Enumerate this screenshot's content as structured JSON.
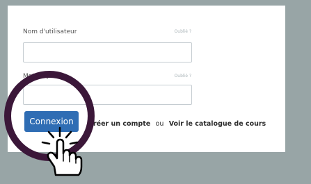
{
  "login_form": {
    "username_label": "Nom d'utilisateur",
    "username_forgot": "Oublié ?",
    "password_label": "Mot de passe",
    "password_forgot": "Oublié ?",
    "submit_label": "Connexion",
    "create_account_link": "Créer un compte",
    "separator": "ou",
    "catalog_link": "Voir le catalogue de cours"
  },
  "annotation": {
    "icon": "pointing-hand-cursor-icon",
    "highlight_color": "#3b1739"
  },
  "colors": {
    "page_bg": "#98a5a6",
    "card_bg": "#ffffff",
    "button_bg": "#2f6db4"
  }
}
